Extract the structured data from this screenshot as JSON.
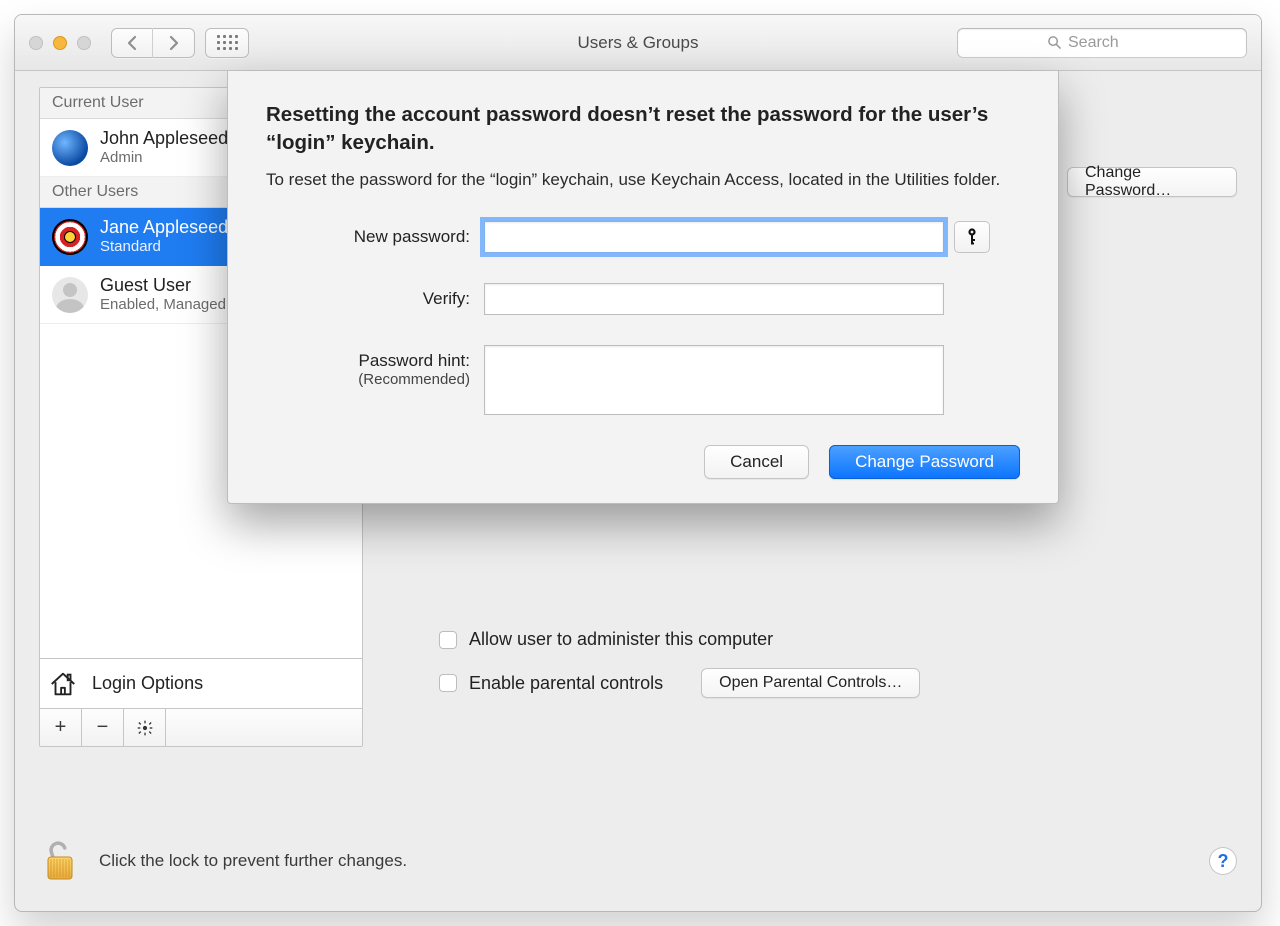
{
  "window": {
    "title": "Users & Groups",
    "search_placeholder": "Search"
  },
  "sidebar": {
    "section_current": "Current User",
    "section_other": "Other Users",
    "users": [
      {
        "name": "John Appleseed",
        "role": "Admin",
        "avatar": "earth",
        "selected": false
      },
      {
        "name": "Jane Appleseed",
        "role": "Standard",
        "avatar": "target",
        "selected": true
      },
      {
        "name": "Guest User",
        "role": "Enabled, Managed",
        "avatar": "guest",
        "selected": false
      }
    ],
    "login_options_label": "Login Options",
    "buttons": {
      "add": "+",
      "remove": "−",
      "gear": "✻"
    }
  },
  "content": {
    "change_password_button": "Change Password…",
    "checkbox_admin": "Allow user to administer this computer",
    "checkbox_parental": "Enable parental controls",
    "open_parental_button": "Open Parental Controls…"
  },
  "footer": {
    "lock_text": "Click the lock to prevent further changes."
  },
  "sheet": {
    "heading": "Resetting the account password doesn’t reset the password for the user’s “login” keychain.",
    "subtext": "To reset the password for the “login” keychain, use Keychain Access, located in the Utilities folder.",
    "labels": {
      "new_password": "New password:",
      "verify": "Verify:",
      "hint": "Password hint:",
      "hint_rec": "(Recommended)"
    },
    "values": {
      "new_password": "",
      "verify": "",
      "hint": ""
    },
    "buttons": {
      "cancel": "Cancel",
      "change": "Change Password"
    }
  }
}
